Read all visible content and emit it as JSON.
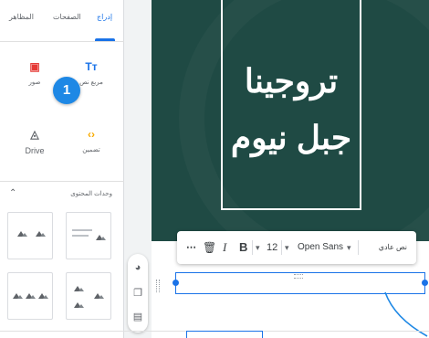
{
  "panel": {
    "tabs": [
      {
        "label": "إدراج",
        "active": true
      },
      {
        "label": "الصفحات",
        "active": false
      },
      {
        "label": "المظاهر",
        "active": false
      }
    ],
    "insert_items": [
      {
        "label": "مربع نص",
        "icon": "text-box-icon",
        "glyph": "Tт"
      },
      {
        "label": "صور",
        "icon": "image-icon",
        "glyph": "▣"
      },
      {
        "label": "تضمين",
        "icon": "embed-code-icon",
        "glyph": "‹›"
      },
      {
        "label": "Drive",
        "icon": "drive-icon",
        "glyph": "◬"
      }
    ],
    "callout_number": "1",
    "layouts_section_title": "وحدات المحتوى"
  },
  "slide": {
    "title_line1": "تروجينا",
    "title_line2": "جبل نيوم",
    "background_color": "#1f4a44"
  },
  "toolbar": {
    "more": "⋯",
    "delete_glyph": "🗑",
    "italic": "I",
    "bold": "B",
    "font_size": "12",
    "font_family": "Open Sans",
    "dropdown_glyph": "▾",
    "style": "نص عادي"
  },
  "colors": {
    "accent": "#1a73e8",
    "callout": "#1e88e5"
  }
}
